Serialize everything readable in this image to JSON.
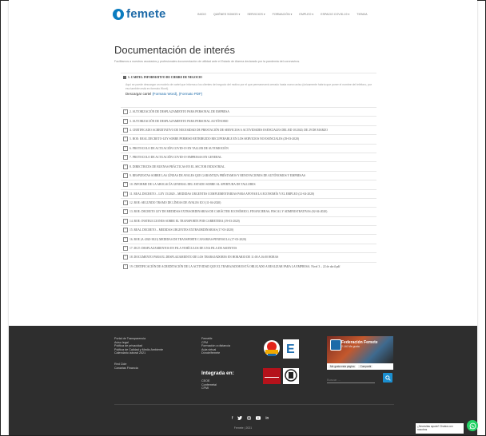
{
  "header": {
    "logo_text": "femete",
    "nav": [
      "INICIO",
      "QUIÉNES SOMOS ▾",
      "SERVICIOS ▾",
      "FORMACIÓN ▾",
      "EMPLEO ▾",
      "ESPACIO COVID-19 ▾",
      "TIENDA"
    ]
  },
  "main": {
    "title": "Documentación de interés",
    "subtitle": "Facilitamos a nuestros asociados y profesionales documentación de utilidad ante el Estado de Alarma declarado por la pandemia del coronavirus.",
    "open_item": {
      "label": "1. CARTEL INFORMATIVO DE CIERRE DE NEGOCIO",
      "description": "Aquí se puede descargar un modelo de cartel que informa a los clientes del negocio del motivo por el que permanecerá cerrado hasta nuevo aviso (únicamente habría que poner el nombre del teléfono, por eso también está en formato Word).",
      "download_prefix": "Descargar cartel",
      "word_link": "(Formato Word)",
      "pdf_link": "(Formato PDF)"
    },
    "items": [
      "2. AUTORIZACIÓN DE DESPLAZAMIENTO PARA PERSONAL DE EMPRESA",
      "3. AUTORIZACIÓN DE DESPLAZAMIENTO PARA PERSONAL AUTÓNOMO",
      "4. CERTIFICADO ACREDITATIVO DE NECESIDAD DE PRESTACIÓN DE SERVICIOS A ACTIVIDADES ESENCIALES DEL RD 10/2020, DE 29 DE MARZO",
      "5. BOE: REAL DECRETO-LEY SOBRE PERMISO RETRIBUIDO RECUPERABLE EN LOS SERVICIOS NO ESENCIALES (29-03-2020)",
      "6. PROTOCOLO DE ACTUACIÓN COVID-19 EN TALLER DE AUTOMOCIÓN",
      "7. PROTOCOLO DE ACTUACIÓN COVID-19 EMPRESAS EN GENERAL",
      "8. DIRECTRICES DE BUENAS PRÁCTICAS EN EL SECTOR INDUSTRIAL",
      "9. RESPUESTAS SOBRE LAS LÍNEAS DE AVALES QUE GARANTIZA PRÉSTAMOS Y RENOVACIONES DE AUTÓNOMOS Y EMPRESAS",
      "10. INFORME DE LA ABOGACÍA GENERAL DEL ESTADO SOBRE AL APERTURA DE TALLERES",
      "11. REAL DECRETO – LEY 15/2020 – MEDIDAS URGENTES COMPLEMENTARIAS PARA APOYAR LA ECONOMÍA Y EL EMPLEO (21-04-2020)",
      "12. BOE: SEGUNDO TRAMO DE LÍNEAS DE AVALES ICO (11-04-2020)",
      "13. BOE: DECRETO LEY DE MEDIDAS EXTRAORDINARIAS DE CARÁCTER ECONÓMICO, FINANCIERAS, FISCAL Y ADMINISTRATIVAS (02-04-2020)",
      "14. BOE: INSTRUCCIONES SOBRE EL TRANSPORTE POR CARRETERA (19-03-2020)",
      "15. REAL DECRETO – MEDIDAS URGENTES EXTRAORDINARIAS (17-03-2020)",
      "16. BOE (A-2020-3821) MEDIDAS DE TRANSPORTE CANARIAS-PENINSULA (17-03-2020)",
      "17. DGT: DESPLAZAMIENTOS EN FILA VEHÍCULOS DE UNA FILA DE ASIENTOS",
      "18. DOCUMENTO PARA EL DESPLAZAMIENTO DE LOS TRABAJADORES EN HORARIO DE 11:00 A 16:00 HORAS",
      "19. CERTIFICACIÓN DE ACREDITACIÓN DE LA ACTIVIDAD QUE EL TRABAJADOR ESTÁ OBLIGADO A REALIZAR PARA LA EMPRESA. Nivel 3 – 22 de abril.pdf"
    ]
  },
  "footer": {
    "col1": [
      "Portal de Transparencia",
      "Aviso legal",
      "Política de privacidad",
      "Política de Calidad y Medio Ambiente",
      "Calendario laboral 2021"
    ],
    "col1b": [
      "Red Cide",
      "Canarias Financia"
    ],
    "col2": [
      "Femetfe",
      "CFM",
      "Formación a distancia",
      "Aula virtual",
      "Dónde/femete"
    ],
    "integrated_title": "Integrada en:",
    "integrated_items": [
      "CEOE",
      "Confemetal",
      "CFMI"
    ],
    "fb_title": "Federación Femete",
    "fb_followers": "2.140 Me gusta",
    "fb_like": "Me gusta esta página",
    "fb_share": "Compartir",
    "search_placeholder": "Buscar ...",
    "copyright": "Femete | 2021"
  },
  "whatsapp": {
    "bubble": "¿Necesitas ayuda? Chatea con nosotros"
  }
}
